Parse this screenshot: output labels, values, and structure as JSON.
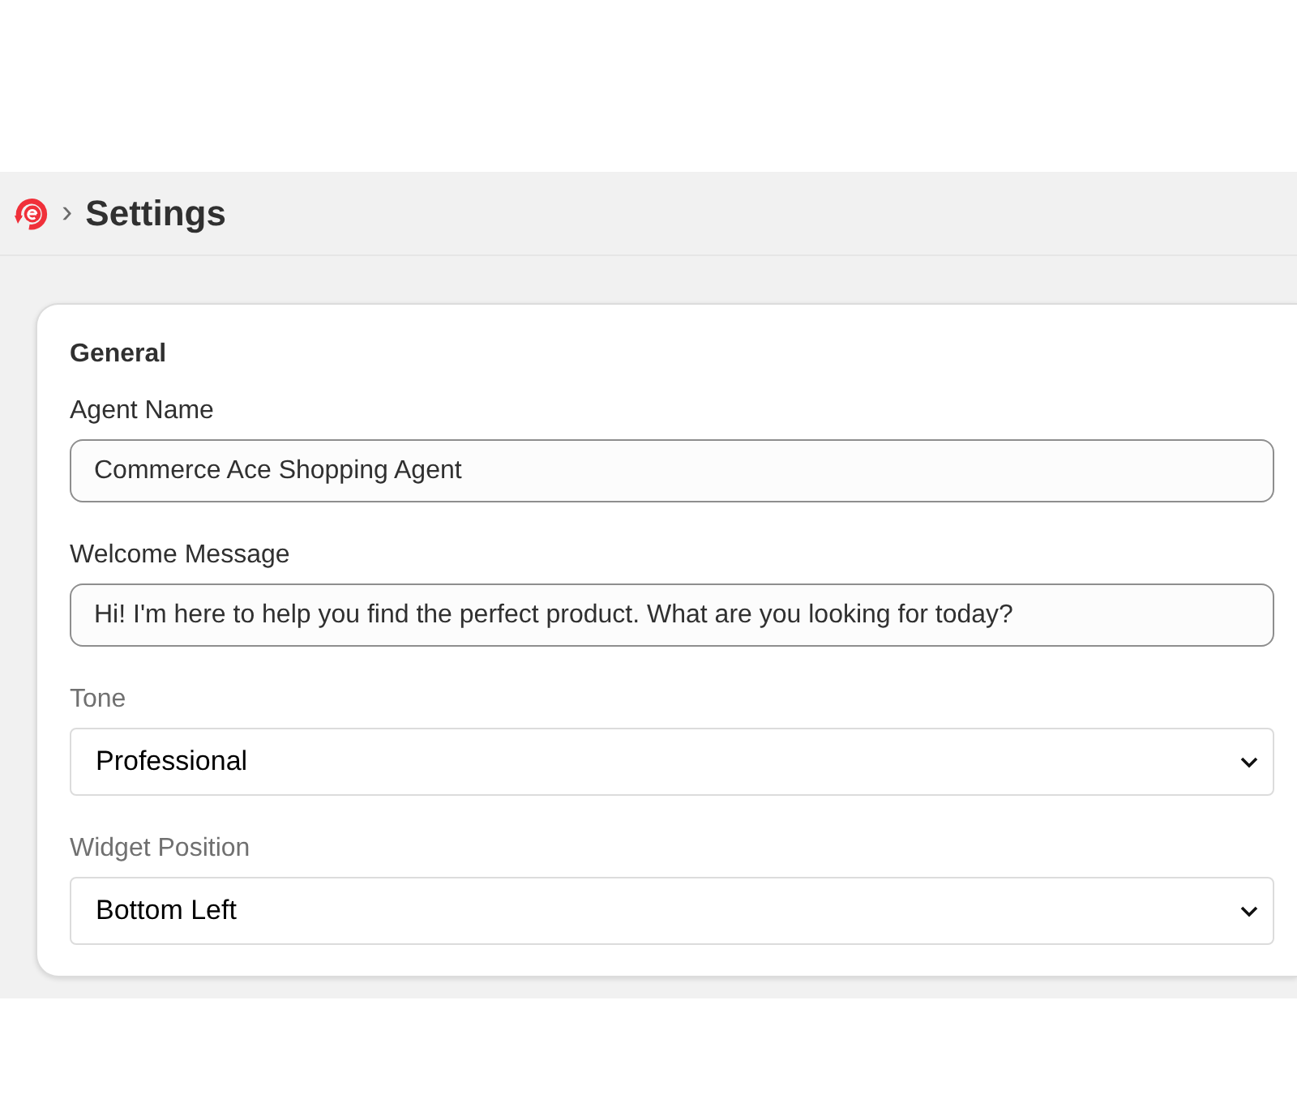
{
  "breadcrumb": {
    "separator": "›",
    "title": "Settings"
  },
  "card": {
    "section_title": "General",
    "fields": [
      {
        "kind": "text",
        "label": "Agent Name",
        "value": "Commerce Ace Shopping Agent"
      },
      {
        "kind": "text",
        "label": "Welcome Message",
        "value": "Hi! I'm here to help you find the perfect product. What are you looking for today?"
      },
      {
        "kind": "select",
        "label": "Tone",
        "value": "Professional"
      },
      {
        "kind": "select",
        "label": "Widget Position",
        "value": "Bottom Left"
      }
    ]
  }
}
